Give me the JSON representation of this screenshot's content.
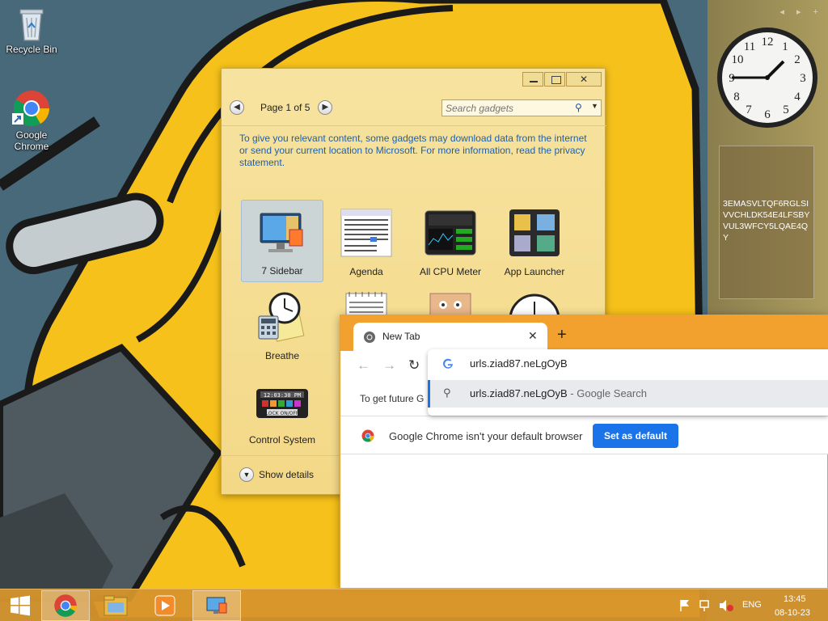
{
  "desktop": {
    "icons": [
      {
        "label": "Recycle Bin",
        "icon": "recycle-bin-icon"
      },
      {
        "label": "Google Chrome",
        "icon": "chrome-icon"
      }
    ]
  },
  "sidebar": {
    "controls": "◂ ▸ +",
    "note_text": "3EMASVLTQF6RGLSIVVCHLDK54E4LFSBYVUL3WFCY5LQAE4QY"
  },
  "gadgets_window": {
    "page_label": "Page 1 of 5",
    "search_placeholder": "Search gadgets",
    "privacy_text": "To give you relevant content, some gadgets may download data from the internet or send your current location to Microsoft. For more information, read the privacy statement.",
    "tiles": [
      {
        "label": "7 Sidebar",
        "icon": "sidebar-monitor-icon",
        "selected": true
      },
      {
        "label": "Agenda",
        "icon": "calendar-icon"
      },
      {
        "label": "All CPU Meter",
        "icon": "cpu-meter-icon"
      },
      {
        "label": "App Launcher",
        "icon": "app-launcher-icon"
      },
      {
        "label": "Breathe",
        "icon": "breathe-clock-icon"
      },
      {
        "label": "",
        "icon": "calendar-page-icon"
      },
      {
        "label": "",
        "icon": "face-photo-icon"
      },
      {
        "label": "",
        "icon": "clock-icon"
      },
      {
        "label": "Control System",
        "icon": "control-system-icon"
      }
    ],
    "show_details": "Show details"
  },
  "chrome": {
    "tab_title": "New Tab",
    "new_tab": "+",
    "infobar_text": "To get future G",
    "default_bar_msg": "Google Chrome isn't your default browser",
    "set_default_label": "Set as default"
  },
  "omnibox": {
    "input": "urls.ziad87.neLgOyB",
    "suggestion_main": "urls.ziad87.neLgOyB",
    "suggestion_sub": " - Google Search"
  },
  "taskbar": {
    "buttons": [
      {
        "name": "start",
        "icon": "windows-start-icon"
      },
      {
        "name": "chrome",
        "icon": "chrome-icon"
      },
      {
        "name": "file-explorer",
        "icon": "folder-icon"
      },
      {
        "name": "media-player",
        "icon": "media-player-icon"
      },
      {
        "name": "gadgets",
        "icon": "gadgets-icon"
      }
    ],
    "lang": "ENG",
    "time": "13:45",
    "date": "08-10-23"
  }
}
